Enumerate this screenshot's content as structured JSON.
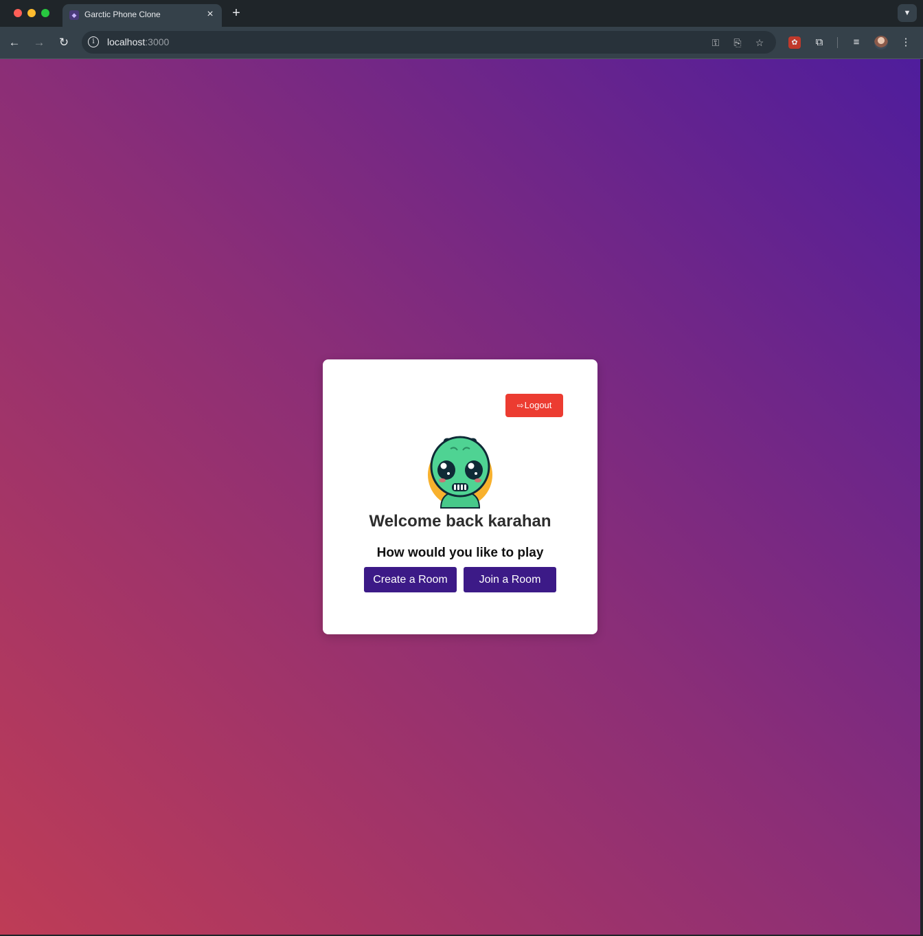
{
  "browser": {
    "tab_title": "Garctic Phone Clone",
    "tab_close": "×",
    "new_tab": "+",
    "url_host": "localhost",
    "url_port": ":3000",
    "icons": [
      "back-icon",
      "forward-icon",
      "reload-icon",
      "site-info-icon",
      "password-key-icon",
      "install-app-icon",
      "bookmark-star-icon",
      "extension-icon",
      "extensions-puzzle-icon",
      "media-control-icon",
      "profile-avatar",
      "more-menu-icon"
    ]
  },
  "page": {
    "logout_label": "Logout",
    "welcome_text": "Welcome back karahan",
    "subtitle": "How would you like to play",
    "create_room_label": "Create a Room",
    "join_room_label": "Join a Room",
    "colors": {
      "background_gradient": [
        "#be3c56",
        "#8b2e77",
        "#4f1d9c"
      ],
      "logout_button": "#ec3c31",
      "room_buttons": "#3c1a87",
      "avatar_face": "#4fd393",
      "avatar_backdrop": "#f8b12d"
    }
  }
}
